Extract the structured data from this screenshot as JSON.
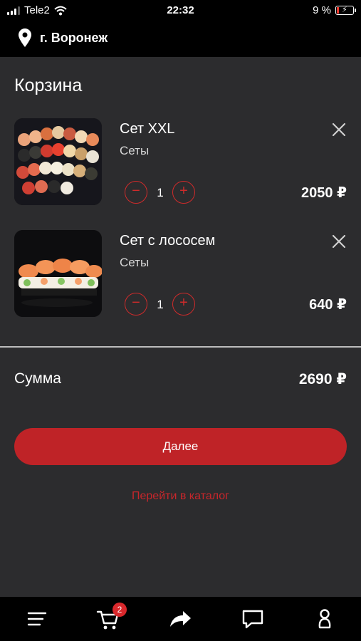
{
  "status_bar": {
    "carrier": "Tele2",
    "time": "22:32",
    "battery_percent": "9 %"
  },
  "location": {
    "city": "г. Воронеж"
  },
  "page": {
    "title": "Корзина"
  },
  "cart": {
    "items": [
      {
        "name": "Сет XXL",
        "category": "Сеты",
        "quantity": "1",
        "price": "2050 ₽"
      },
      {
        "name": "Сет с лососем",
        "category": "Сеты",
        "quantity": "1",
        "price": "640 ₽"
      }
    ],
    "qty_minus": "−",
    "qty_plus": "+"
  },
  "summary": {
    "label": "Сумма",
    "total": "2690 ₽"
  },
  "actions": {
    "next_label": "Далее",
    "catalog_link": "Перейти в каталог"
  },
  "tabbar": {
    "cart_badge": "2",
    "icons": [
      "menu-icon",
      "cart-icon",
      "share-icon",
      "chat-icon",
      "profile-icon"
    ]
  },
  "colors": {
    "accent": "#bf2327",
    "background": "#2c2c2e",
    "bars": "#000000"
  }
}
